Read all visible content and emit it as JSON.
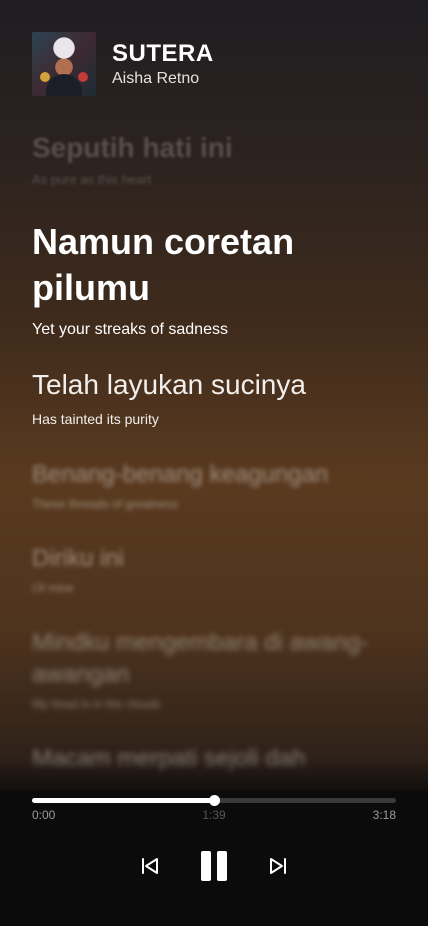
{
  "track": {
    "title": "SUTERA",
    "artist": "Aisha Retno"
  },
  "lyrics": [
    {
      "original": "Seputih hati ini",
      "translation": "As pure as this heart",
      "state": "past"
    },
    {
      "original": "Namun coretan pilumu",
      "translation": "Yet your streaks of sadness",
      "state": "current"
    },
    {
      "original": "Telah layukan sucinya",
      "translation": "Has tainted its purity",
      "state": "next"
    },
    {
      "original": "Benang-benang keagungan",
      "translation": "These threads of greatness",
      "state": "upcoming"
    },
    {
      "original": "Diriku ini",
      "translation": "Of mine",
      "state": "upcoming"
    },
    {
      "original": "Mindku mengembara di awang-awangan",
      "translation": "My head is in the clouds",
      "state": "upcoming"
    },
    {
      "original": "Macam merpati sejoli dah",
      "translation": "",
      "state": "upcoming"
    }
  ],
  "playback": {
    "elapsed": "0:00",
    "marker": "1:39",
    "total": "3:18",
    "progress": 0.5,
    "state": "playing"
  },
  "icons": {
    "previous": "skip-back-icon",
    "pause": "pause-icon",
    "next": "skip-forward-icon"
  }
}
